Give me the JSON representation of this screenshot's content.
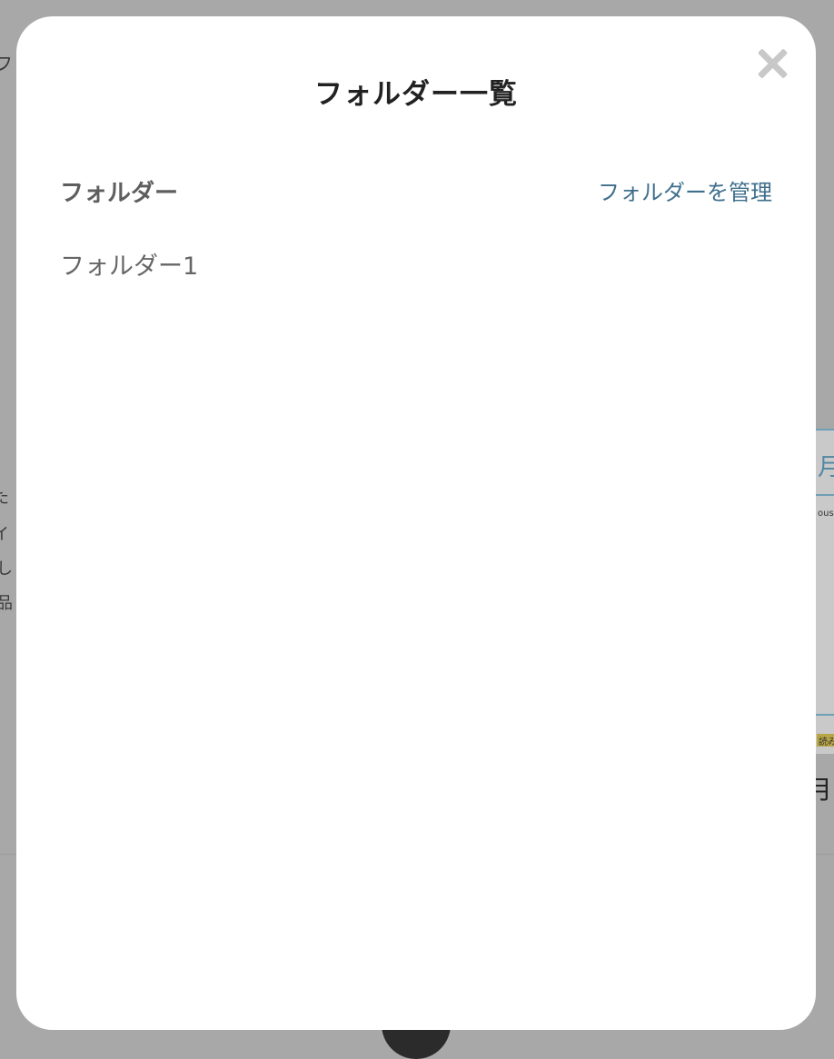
{
  "modal": {
    "title": "フォルダー一覧",
    "close_icon": "close-icon",
    "section_label": "フォルダー",
    "manage_link": "フォルダーを管理",
    "folders": [
      "フォルダー1"
    ]
  },
  "background": {
    "fragments": [
      "フ",
      "た",
      "イ",
      "し",
      "品"
    ],
    "thumb": {
      "heading": "月",
      "sub": "ous",
      "tag": "読み",
      "caption": "月"
    }
  },
  "colors": {
    "overlay": "#a8a8a8",
    "modal_bg": "#ffffff",
    "link": "#3f6f8c",
    "title": "#222222",
    "close": "#c8c8c8"
  }
}
